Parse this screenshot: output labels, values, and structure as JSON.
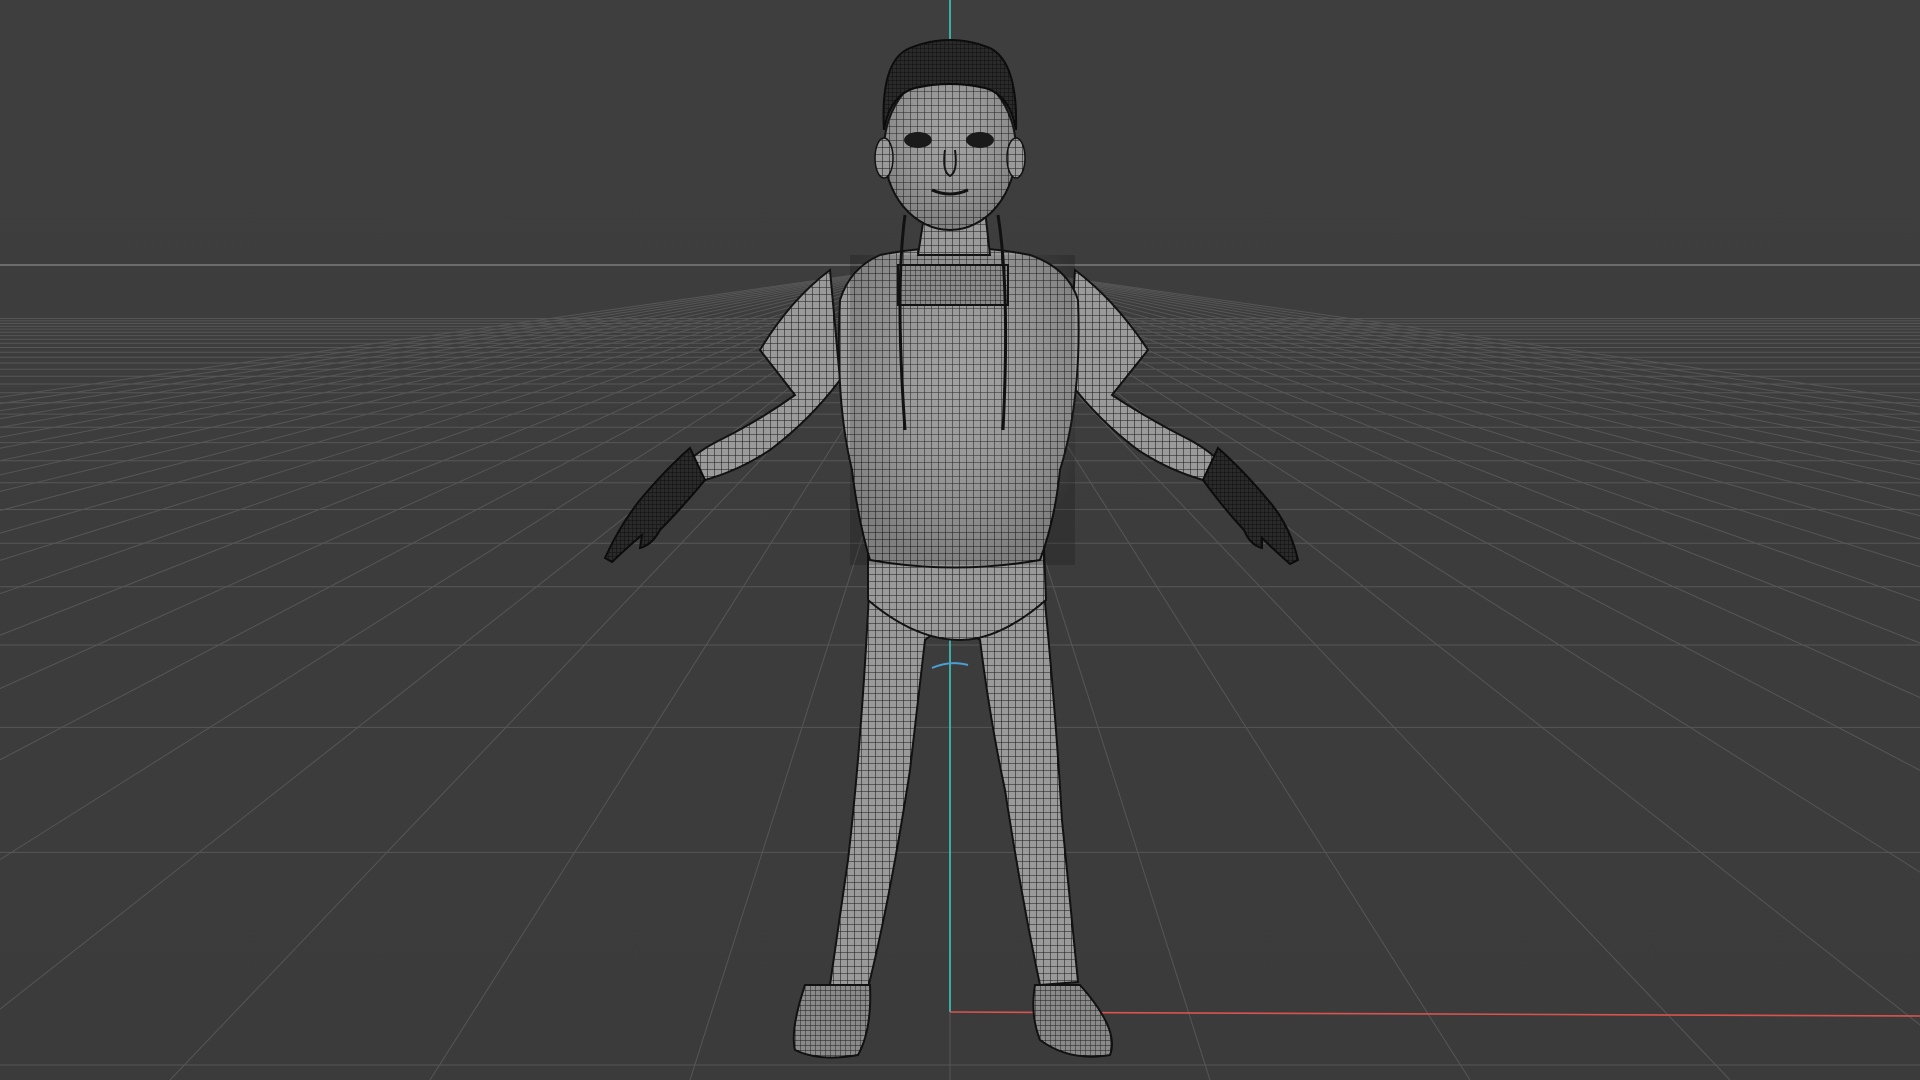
{
  "viewport": {
    "background": "#3d3d3d",
    "grid_color": "#5a5a5a",
    "horizon_color": "#7a7a7a",
    "shading_mode": "wireframe",
    "model": "character-in-a-pose",
    "axes": {
      "x_color": "#d9534f",
      "y_color": "#3ec7c0",
      "z_color": "#4a9fd6"
    },
    "mesh": {
      "fill": "#8e8e8e",
      "wire": "#1a1a1a",
      "dark": "#141414"
    }
  }
}
